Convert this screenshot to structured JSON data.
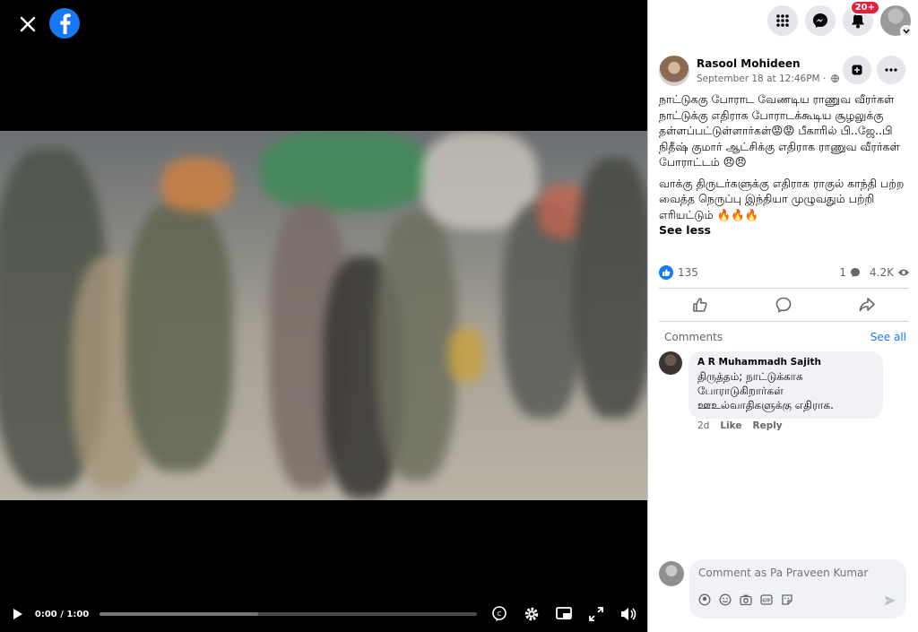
{
  "header": {
    "close_icon": "close-icon",
    "logo_icon": "facebook-logo-icon",
    "brand_color": "#1877f2"
  },
  "video": {
    "time": "0:00 / 1:00",
    "progress_played_fraction": 0.0,
    "progress_buffered_fraction": 0.42
  },
  "topbar": {
    "notification_count": "20+"
  },
  "post": {
    "author": "Rasool Mohideen",
    "date": "September 18 at 12:46PM ·",
    "text_paragraph_1": "நாட்டுககு போராட வேணடிய ராணுவ வீரர்கள் நாட்டுக்கு எதிராக போராடக்கூடிய சூழலுக்கு தள்ளப்பட்டுள்ளார்கள்😡😡 பீகாரில் பி..ஜே..பி நிதீஷ் குமார் ஆட்சிக்கு எதிராக ராணுவ வீரர்கள் போராட்டம் 😠😠",
    "text_paragraph_2": "வாக்கு திருடர்களுக்கு எதிராக ராகுல் காந்தி பற்ற வைத்த நெருப்பு இந்தியா முழுவதும் பற்றி எரியட்டும் 🔥🔥🔥",
    "see_less": "See less",
    "reaction_count": "135",
    "comment_count": "1",
    "view_count": "4.2K"
  },
  "comments": {
    "header": "Comments",
    "see_all": "See all",
    "items": [
      {
        "name": "A R Muhammadh Sajith",
        "text": "திருத்தம்; நாட்டுக்காக போராடுகிறார்கள் ஊஉல்வாதிகளுக்கு எதிராக.",
        "age": "2d",
        "like": "Like",
        "reply": "Reply"
      }
    ]
  },
  "composer": {
    "placeholder": "Comment as Pa Praveen Kumar"
  }
}
